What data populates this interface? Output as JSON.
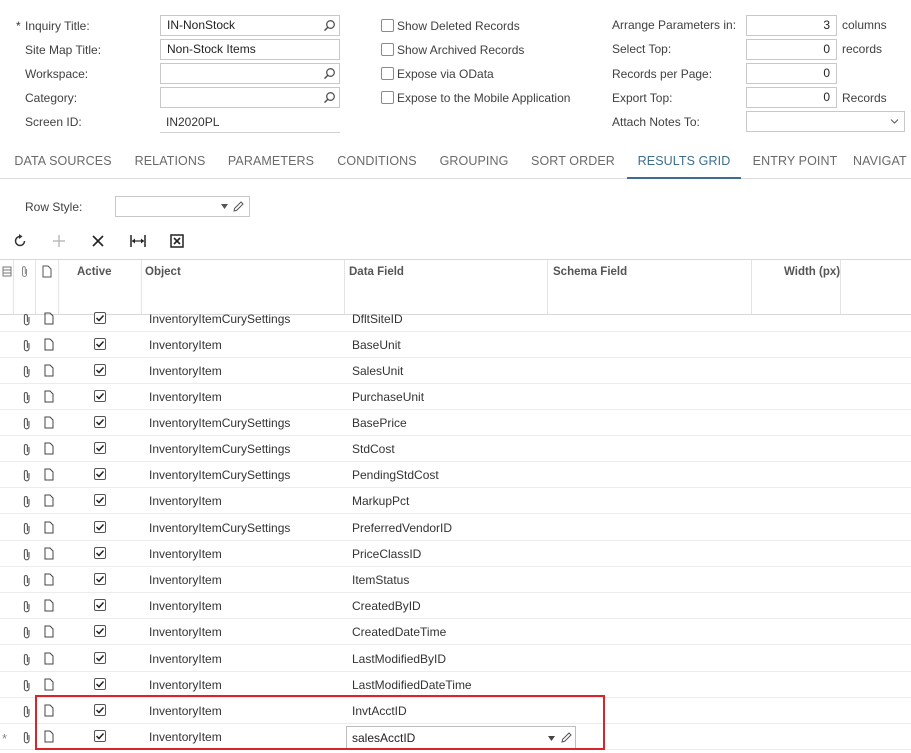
{
  "form": {
    "required_mark": "*",
    "inquiry_title_label": "Inquiry Title:",
    "inquiry_title_value": "IN-NonStock",
    "site_map_title_label": "Site Map Title:",
    "site_map_title_value": "Non-Stock Items",
    "workspace_label": "Workspace:",
    "workspace_value": "",
    "category_label": "Category:",
    "category_value": "",
    "screen_id_label": "Screen ID:",
    "screen_id_value": "IN2020PL"
  },
  "options": {
    "show_deleted": "Show Deleted Records",
    "show_archived": "Show Archived Records",
    "expose_odata": "Expose via OData",
    "expose_mobile": "Expose to the Mobile Application"
  },
  "params": {
    "arrange_label": "Arrange Parameters in:",
    "arrange_value": "3",
    "arrange_unit": "columns",
    "select_top_label": "Select Top:",
    "select_top_value": "0",
    "select_top_unit": "records",
    "records_per_page_label": "Records per Page:",
    "records_per_page_value": "0",
    "export_top_label": "Export Top:",
    "export_top_value": "0",
    "export_top_unit": "Records",
    "attach_notes_label": "Attach Notes To:",
    "attach_notes_value": ""
  },
  "tabs": [
    "DATA SOURCES",
    "RELATIONS",
    "PARAMETERS",
    "CONDITIONS",
    "GROUPING",
    "SORT ORDER",
    "RESULTS GRID",
    "ENTRY POINT",
    "NAVIGAT"
  ],
  "row_style": {
    "label": "Row Style:",
    "value": ""
  },
  "grid": {
    "headers": {
      "active": "Active",
      "object": "Object",
      "data_field": "Data Field",
      "schema_field": "Schema Field",
      "width": "Width (px)"
    },
    "rows": [
      {
        "object": "InventoryItemCurySettings",
        "field": "DfltSiteID"
      },
      {
        "object": "InventoryItem",
        "field": "BaseUnit"
      },
      {
        "object": "InventoryItem",
        "field": "SalesUnit"
      },
      {
        "object": "InventoryItem",
        "field": "PurchaseUnit"
      },
      {
        "object": "InventoryItemCurySettings",
        "field": "BasePrice"
      },
      {
        "object": "InventoryItemCurySettings",
        "field": "StdCost"
      },
      {
        "object": "InventoryItemCurySettings",
        "field": "PendingStdCost"
      },
      {
        "object": "InventoryItem",
        "field": "MarkupPct"
      },
      {
        "object": "InventoryItemCurySettings",
        "field": "PreferredVendorID"
      },
      {
        "object": "InventoryItem",
        "field": "PriceClassID"
      },
      {
        "object": "InventoryItem",
        "field": "ItemStatus"
      },
      {
        "object": "InventoryItem",
        "field": "CreatedByID"
      },
      {
        "object": "InventoryItem",
        "field": "CreatedDateTime"
      },
      {
        "object": "InventoryItem",
        "field": "LastModifiedByID"
      },
      {
        "object": "InventoryItem",
        "field": "LastModifiedDateTime"
      },
      {
        "object": "InventoryItem",
        "field": "InvtAcctID"
      },
      {
        "object": "InventoryItem",
        "field": "salesAcctID"
      }
    ],
    "new_row_marker": "*"
  },
  "colors": {
    "accent": "#3b6e8f",
    "highlight": "#d9252a"
  }
}
